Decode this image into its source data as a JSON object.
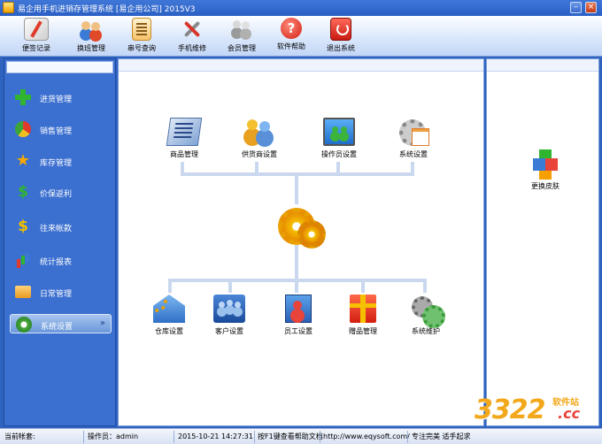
{
  "window": {
    "title": "易企用手机进销存管理系统 [易企用公司] 2015V3",
    "min_label": "–",
    "close_label": "×"
  },
  "toolbar": {
    "items": [
      {
        "label": "便签记录",
        "icon": "note-pen-icon"
      },
      {
        "label": "换班管理",
        "icon": "shift-people-icon"
      },
      {
        "label": "串号查询",
        "icon": "serial-doc-icon"
      },
      {
        "label": "手机维修",
        "icon": "repair-tools-icon"
      },
      {
        "label": "会员管理",
        "icon": "members-icon"
      },
      {
        "label": "软件帮助",
        "icon": "help-icon",
        "glyph": "?"
      },
      {
        "label": "退出系统",
        "icon": "exit-power-icon"
      }
    ]
  },
  "sidebar": {
    "items": [
      {
        "label": "进货管理",
        "icon": "plus-icon"
      },
      {
        "label": "销售管理",
        "icon": "pie-chart-icon"
      },
      {
        "label": "库存管理",
        "icon": "star-icon",
        "glyph": "★"
      },
      {
        "label": "价保返利",
        "icon": "dollar-green-icon",
        "glyph": "$"
      },
      {
        "label": "往来帐款",
        "icon": "dollar-gold-icon",
        "glyph": "$"
      },
      {
        "label": "统计报表",
        "icon": "bar-chart-icon"
      },
      {
        "label": "日常管理",
        "icon": "folder-icon"
      },
      {
        "label": "系统设置",
        "icon": "gear-icon",
        "active": true,
        "chevron": "»"
      }
    ]
  },
  "main": {
    "top_modules": [
      {
        "label": "商品管理",
        "icon": "goods-icon"
      },
      {
        "label": "供货商设置",
        "icon": "supplier-icon"
      },
      {
        "label": "操作员设置",
        "icon": "operator-icon"
      },
      {
        "label": "系统设置",
        "icon": "system-settings-icon"
      }
    ],
    "center_icon": "gears-icon",
    "bottom_modules": [
      {
        "label": "仓库设置",
        "icon": "warehouse-icon"
      },
      {
        "label": "客户设置",
        "icon": "customer-icon"
      },
      {
        "label": "员工设置",
        "icon": "staff-icon"
      },
      {
        "label": "赠品管理",
        "icon": "gift-icon"
      },
      {
        "label": "系统维护",
        "icon": "maintenance-icon"
      }
    ]
  },
  "right_panel": {
    "skin_label": "更换皮肤",
    "skin_icon": "cubes-icon"
  },
  "statusbar": {
    "current_account_label": "当前帐套:",
    "operator_label": "操作员：admin",
    "datetime": "2015-10-21 14:27:31",
    "help_hint": "按F1键查看帮助文档",
    "website": "http://www.eqysoft.com/",
    "slogan": "专注完美 适手起求"
  },
  "watermark": {
    "big": "3322",
    "small": "软件站",
    "cc": ".cc"
  }
}
